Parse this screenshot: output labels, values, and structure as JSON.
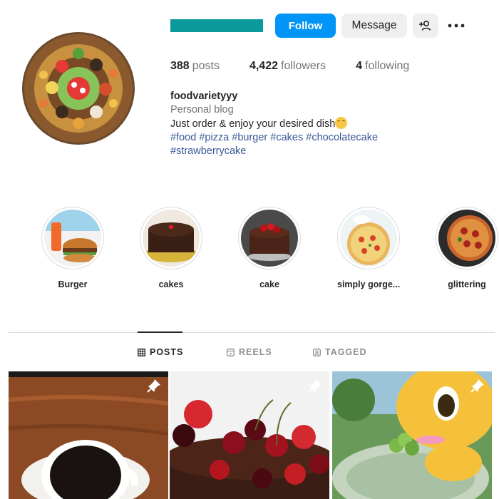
{
  "profile": {
    "username": "foodvarietyyy",
    "username_bar_color": "#0a9a9c",
    "category": "Personal blog",
    "bio_text": "Just order & enjoy your desired dish",
    "bio_emoji": "smiling-face-icon",
    "hashtags_line1": [
      "#food",
      "#pizza",
      "#burger",
      "#cakes",
      "#chocolatecake"
    ],
    "hashtags_line2": [
      "#strawberrycake"
    ]
  },
  "actions": {
    "follow_label": "Follow",
    "message_label": "Message",
    "add_user_icon": "add-user-icon",
    "more_icon": "more-icon",
    "follow_color": "#0095f6"
  },
  "stats": {
    "posts_count": "388",
    "posts_label": "posts",
    "followers_count": "4,422",
    "followers_label": "followers",
    "following_count": "4",
    "following_label": "following"
  },
  "highlights": [
    {
      "label": "Burger"
    },
    {
      "label": "cakes"
    },
    {
      "label": "cake"
    },
    {
      "label": "simply gorge..."
    },
    {
      "label": "glittering"
    }
  ],
  "tabs": [
    {
      "label": "POSTS",
      "icon": "grid-icon",
      "active": true
    },
    {
      "label": "REELS",
      "icon": "reels-icon",
      "active": false
    },
    {
      "label": "TAGGED",
      "icon": "tagged-icon",
      "active": false
    }
  ],
  "posts": [
    {
      "subject": "coffee-cup",
      "pinned": true
    },
    {
      "subject": "cherry-chocolate-cake",
      "pinned": true
    },
    {
      "subject": "yellow-3d-character",
      "pinned": true
    }
  ]
}
